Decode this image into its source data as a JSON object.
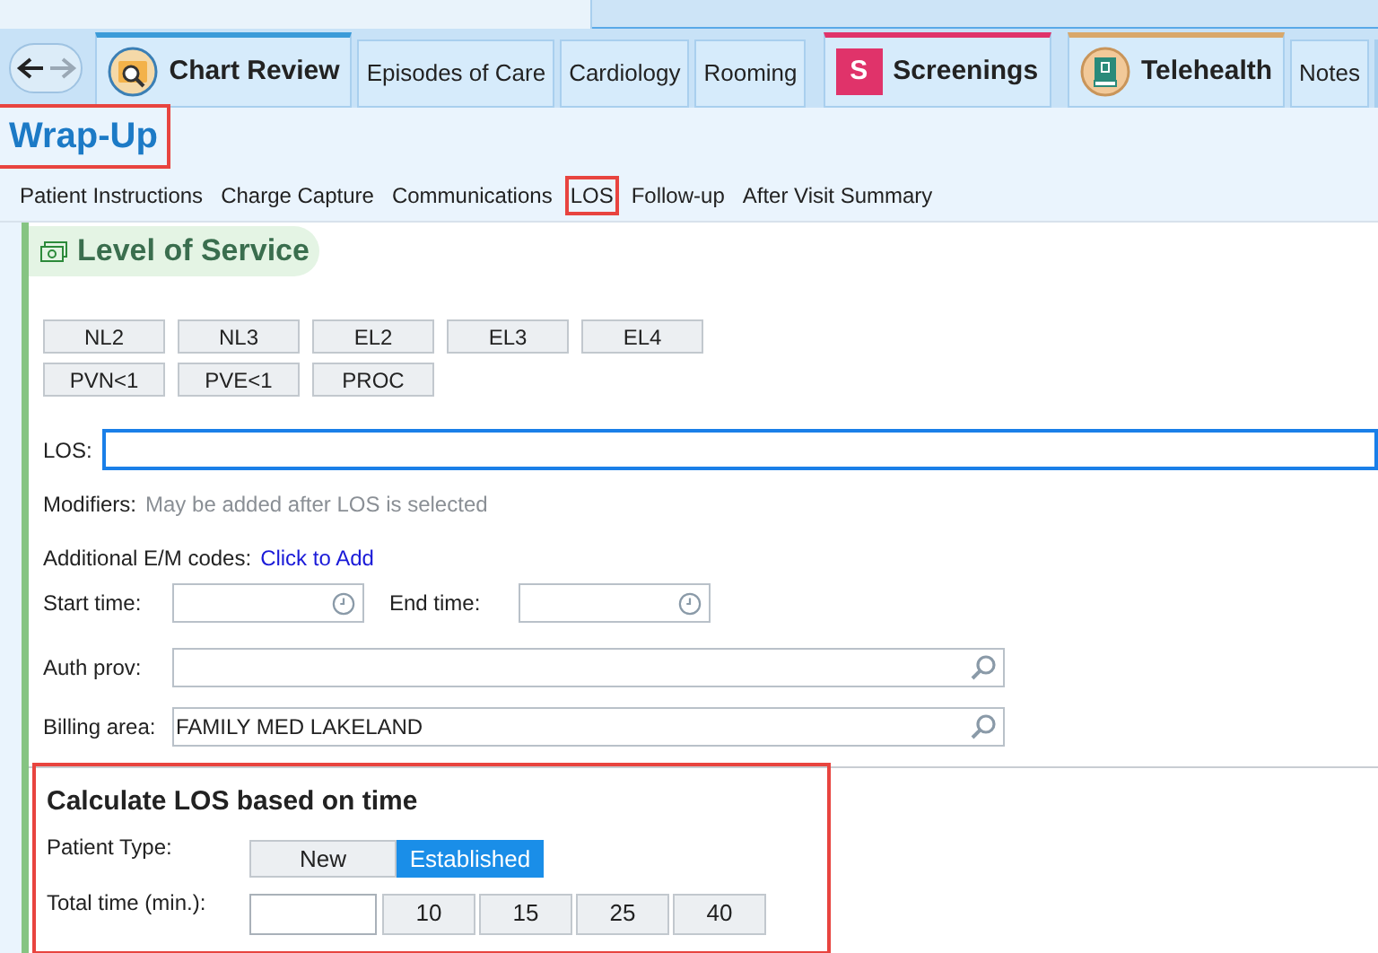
{
  "activity_tabs": [
    {
      "label": "Chart Review",
      "kind": "folder",
      "color": "#3b9bd8"
    },
    {
      "label": "Episodes of Care",
      "kind": "plain"
    },
    {
      "label": "Cardiology",
      "kind": "plain"
    },
    {
      "label": "Rooming",
      "kind": "plain"
    },
    {
      "label": "Screenings",
      "kind": "letter",
      "icon_text": "S",
      "color": "#e0336a"
    },
    {
      "label": "Telehealth",
      "kind": "book",
      "color": "#d9a86a"
    },
    {
      "label": "Notes",
      "kind": "plain"
    }
  ],
  "page_title": {
    "text": "Wrap-Up",
    "highlighted": true
  },
  "section_tabs": [
    {
      "label": "Patient Instructions",
      "highlighted": false
    },
    {
      "label": "Charge Capture",
      "highlighted": false
    },
    {
      "label": "Communications",
      "highlighted": false
    },
    {
      "label": "LOS",
      "highlighted": true
    },
    {
      "label": "Follow-up",
      "highlighted": false
    },
    {
      "label": "After Visit Summary",
      "highlighted": false
    }
  ],
  "section": {
    "title": "Level of Service",
    "code_buttons": [
      [
        "NL2",
        "NL3",
        "EL2",
        "EL3",
        "EL4"
      ],
      [
        "PVN<1",
        "PVE<1",
        "PROC"
      ]
    ],
    "los_label": "LOS:",
    "modifiers_label": "Modifiers:",
    "modifiers_note": "May be added after LOS is selected",
    "additional_label": "Additional E/M codes:",
    "additional_link": "Click to Add",
    "start_label": "Start time:",
    "end_label": "End time:",
    "auth_label": "Auth prov:",
    "billing_label": "Billing area:",
    "billing_value": "FAMILY MED LAKELAND"
  },
  "calculator": {
    "title": "Calculate LOS based on time",
    "highlighted": true,
    "patient_type_label": "Patient Type:",
    "patient_types": [
      {
        "label": "New",
        "selected": false
      },
      {
        "label": "Established",
        "selected": true
      }
    ],
    "total_label": "Total time (min.):",
    "minutes": [
      "10",
      "15",
      "25",
      "40"
    ]
  }
}
